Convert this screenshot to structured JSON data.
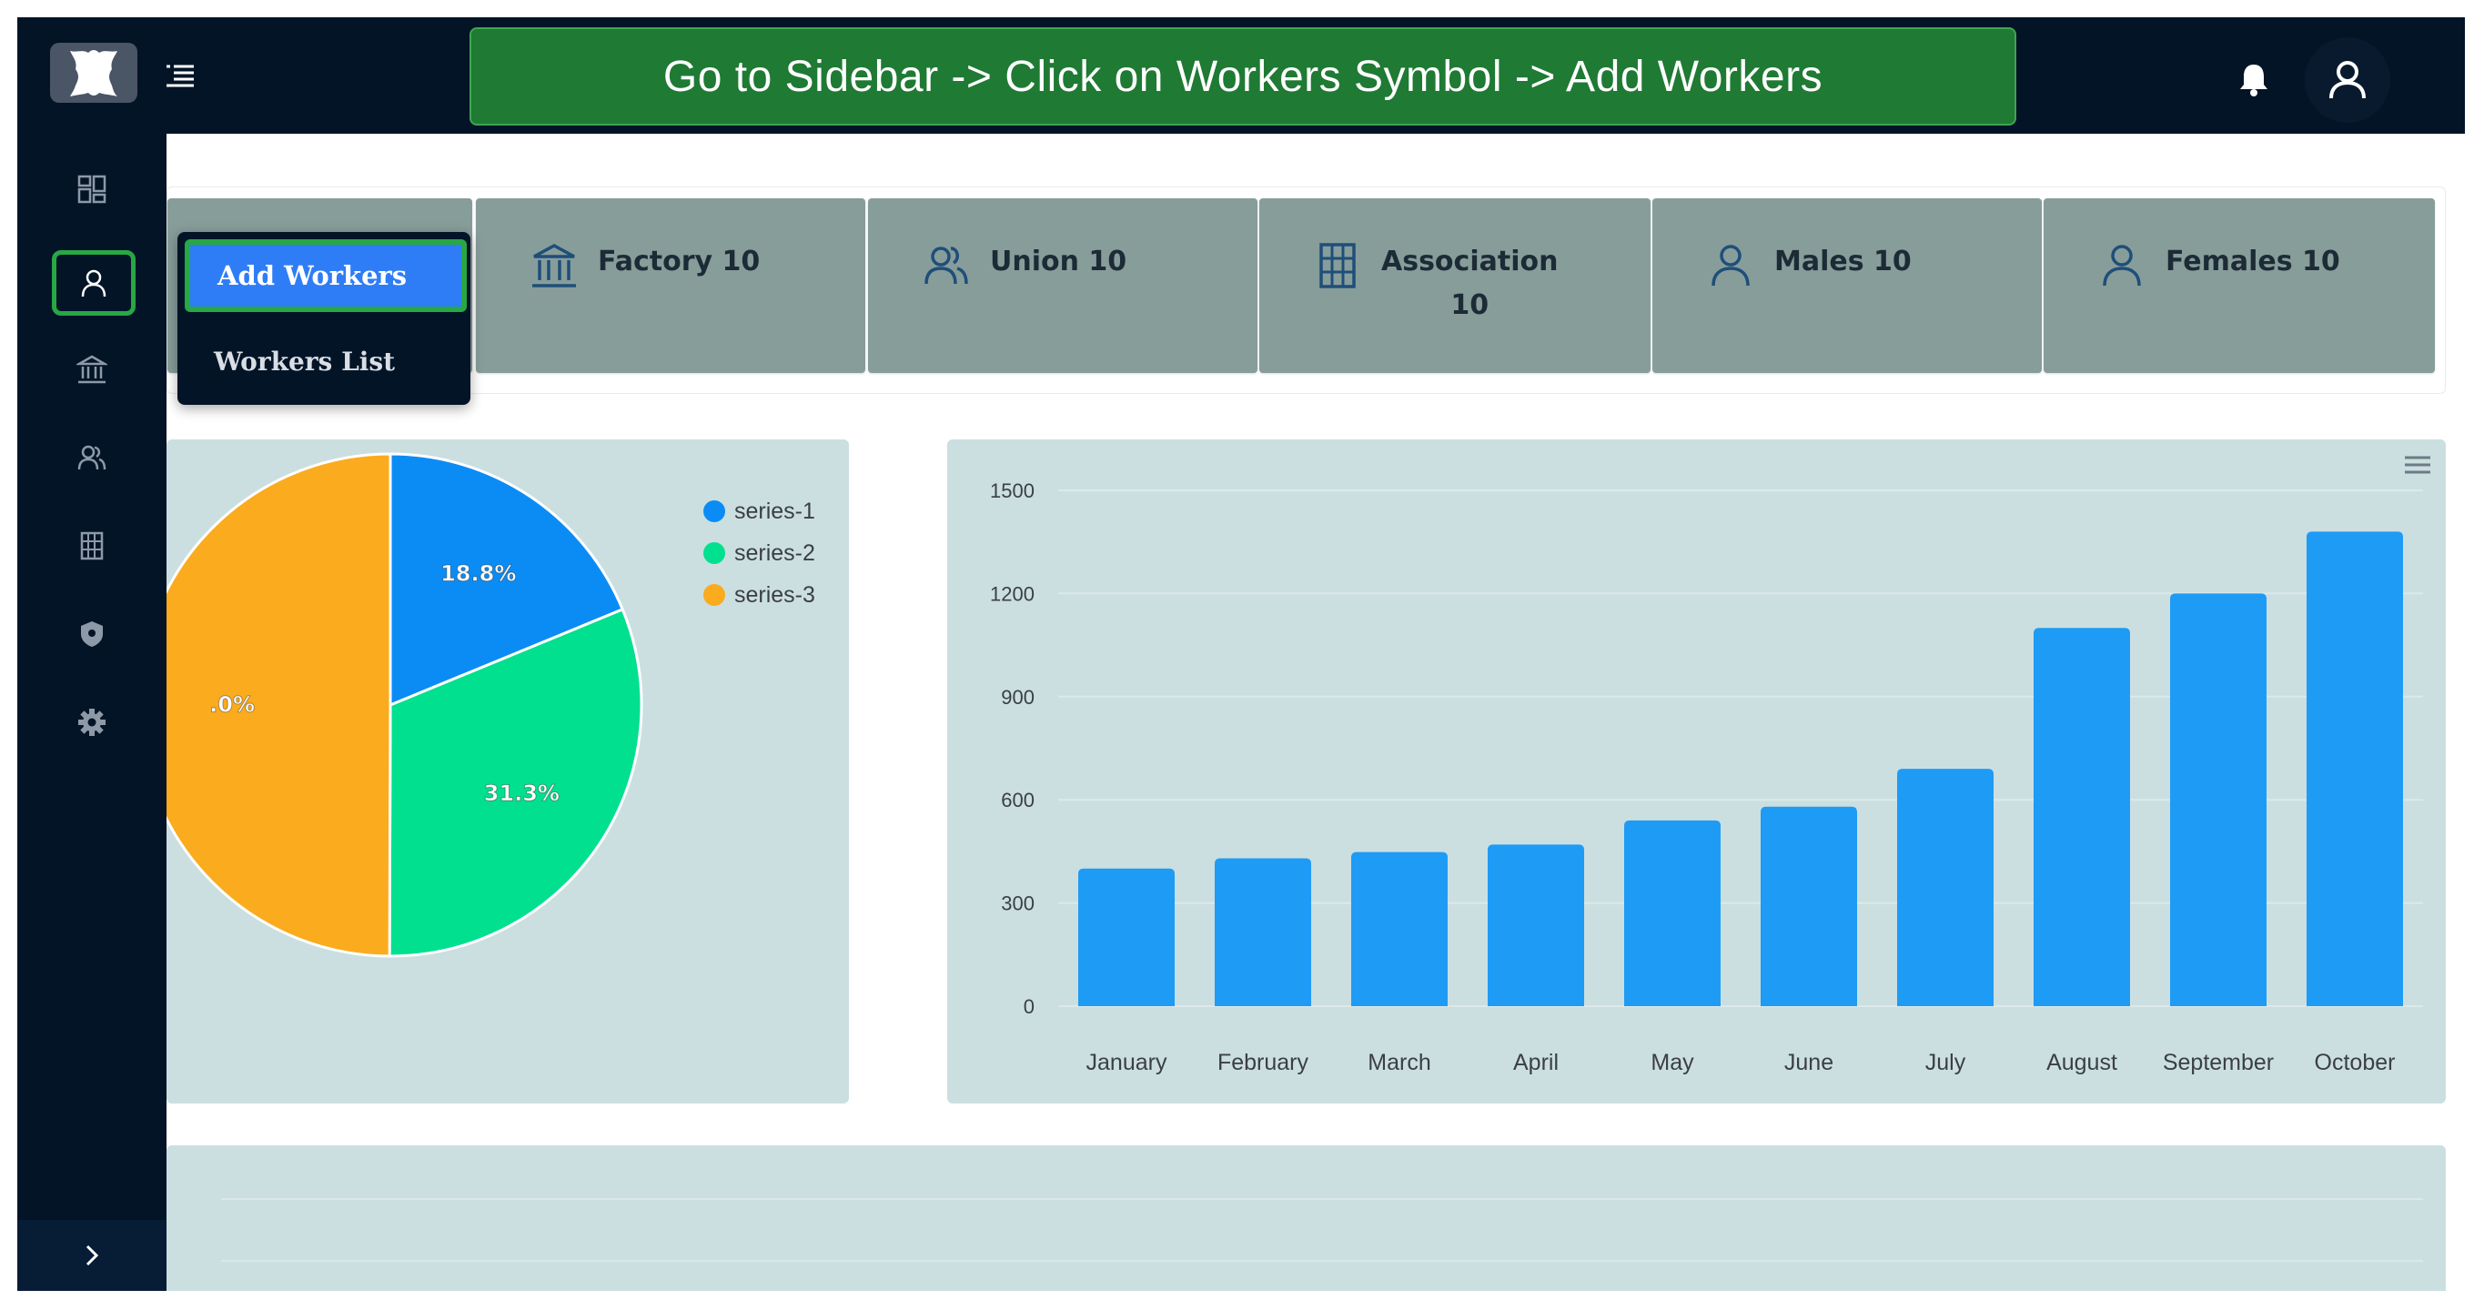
{
  "banner": {
    "text": "Go to Sidebar -> Click on Workers Symbol -> Add Workers"
  },
  "header": {
    "icons": [
      "leather-logo",
      "menu-toggle-icon",
      "bell-icon",
      "user-icon"
    ]
  },
  "sidebar": {
    "items": [
      {
        "name": "dashboard",
        "icon": "dashboard-grid-icon"
      },
      {
        "name": "workers",
        "icon": "user-icon",
        "active": true
      },
      {
        "name": "factory",
        "icon": "bank-icon"
      },
      {
        "name": "union",
        "icon": "users-icon"
      },
      {
        "name": "association",
        "icon": "building-icon"
      },
      {
        "name": "security",
        "icon": "shield-icon"
      },
      {
        "name": "settings",
        "icon": "gear-icon"
      }
    ],
    "expand_icon": "chevron-right-icon"
  },
  "dropdown": {
    "items": [
      {
        "label": "Add Workers",
        "highlighted": true
      },
      {
        "label": "Workers List"
      }
    ]
  },
  "stats": {
    "cards": [
      {
        "label": "Factory 10",
        "icon": "bank-icon"
      },
      {
        "label": "Union 10",
        "icon": "users-icon"
      },
      {
        "label": "Association",
        "value": "10",
        "icon": "building-icon"
      },
      {
        "label": "Males 10",
        "icon": "user-icon"
      },
      {
        "label": "Females 10",
        "icon": "user-icon"
      }
    ]
  },
  "colors": {
    "accent": "#2f7df6",
    "highlight_border": "#28a745",
    "banner_bg": "#1f7a33",
    "sidebar_bg": "#031427",
    "panel_bg": "#cbdfe1",
    "card_bg": "#879d9a"
  },
  "chart_data": [
    {
      "type": "pie",
      "labels": [
        "series-1",
        "series-2",
        "series-3"
      ],
      "values": [
        18.8,
        31.3,
        50.0
      ],
      "data_labels": [
        "18.8%",
        "31.3%",
        ".0%"
      ],
      "colors": [
        "#0b8cf5",
        "#00e08f",
        "#fbab1e"
      ],
      "legend": "top-right"
    },
    {
      "type": "bar",
      "categories": [
        "January",
        "February",
        "March",
        "April",
        "May",
        "June",
        "July",
        "August",
        "September",
        "October"
      ],
      "values": [
        400,
        430,
        448,
        470,
        540,
        580,
        690,
        1100,
        1200,
        1380
      ],
      "ylim": [
        0,
        1500
      ],
      "yticks": [
        "0",
        "300",
        "600",
        "900",
        "1200",
        "1500"
      ],
      "color": "#1e9bf5",
      "grid": true
    }
  ]
}
